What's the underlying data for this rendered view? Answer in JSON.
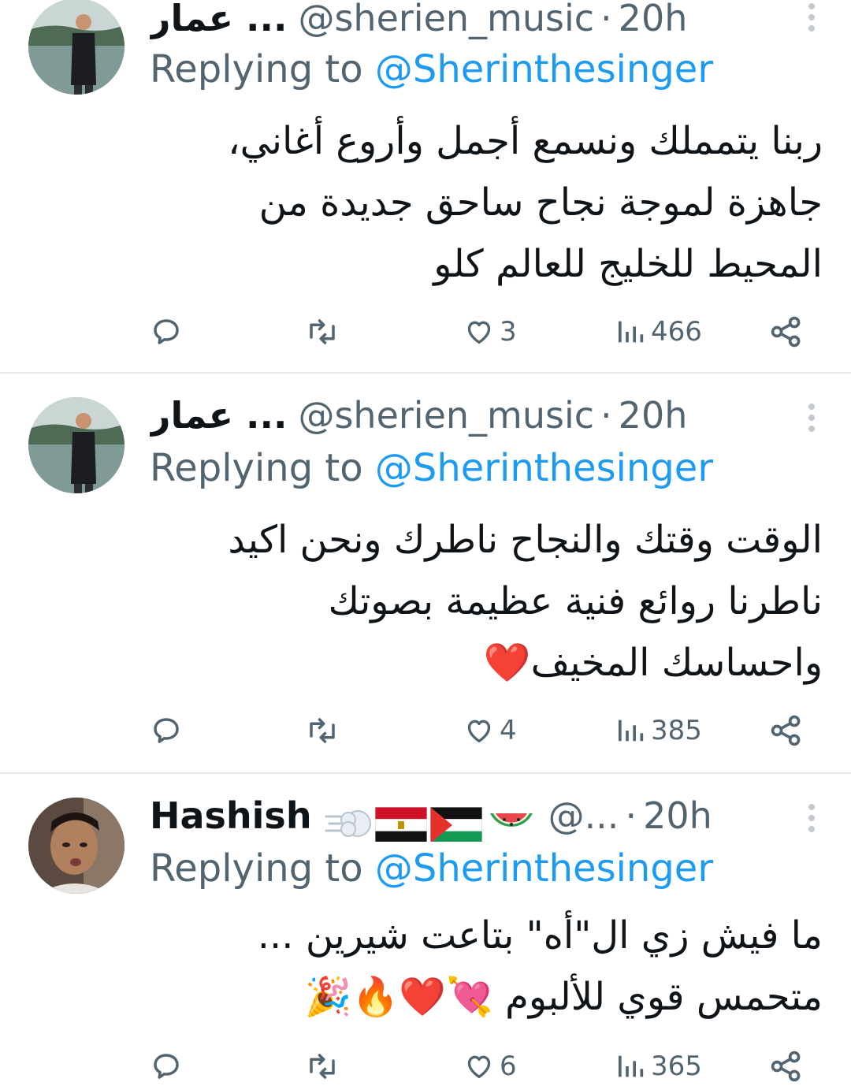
{
  "tweets": [
    {
      "name": "عمار ...",
      "handle": "@sherien_music",
      "dot": "·",
      "time": "20h",
      "replying_prefix": "Replying to ",
      "replying_to": "@Sherinthesinger",
      "lines": [
        "ربنا يتمملك ونسمع أجمل وأروع أغاني،",
        "جاهزة لموجة نجاح ساحق جديدة من",
        "المحيط للخليج للعالم كلو"
      ],
      "likes": "3",
      "views": "466"
    },
    {
      "name": "عمار ...",
      "handle": "@sherien_music",
      "dot": "·",
      "time": "20h",
      "replying_prefix": "Replying to ",
      "replying_to": "@Sherinthesinger",
      "lines": [
        "الوقت وقتك والنجاح ناطرك ونحن اكيد",
        "ناطرنا روائع فنية عظيمة بصوتك",
        "واحساسك المخيف❤️"
      ],
      "likes": "4",
      "views": "385"
    },
    {
      "name": "Hashish",
      "handle": "@...",
      "dot": "·",
      "time": "20h",
      "name_emojis": [
        "dash-symbol",
        "flag-egypt",
        "flag-palestine",
        "watermelon"
      ],
      "replying_prefix": "Replying to ",
      "replying_to": "@Sherinthesinger",
      "lines": [
        "ما فيش زي ال\"أه\" بتاعت شيرين ...",
        "متحمس قوي للألبوم 💘❤️🔥🎉"
      ],
      "likes": "6",
      "views": "365"
    }
  ],
  "icons": {
    "reply": "reply-icon",
    "retweet": "retweet-icon",
    "like": "heart-icon",
    "views": "views-icon",
    "share": "share-icon",
    "more": "more-vertical-icon"
  },
  "colors": {
    "text": "#0f1419",
    "secondary": "#536471",
    "accent": "#1d9bf0",
    "divider": "#e6e9ec"
  }
}
